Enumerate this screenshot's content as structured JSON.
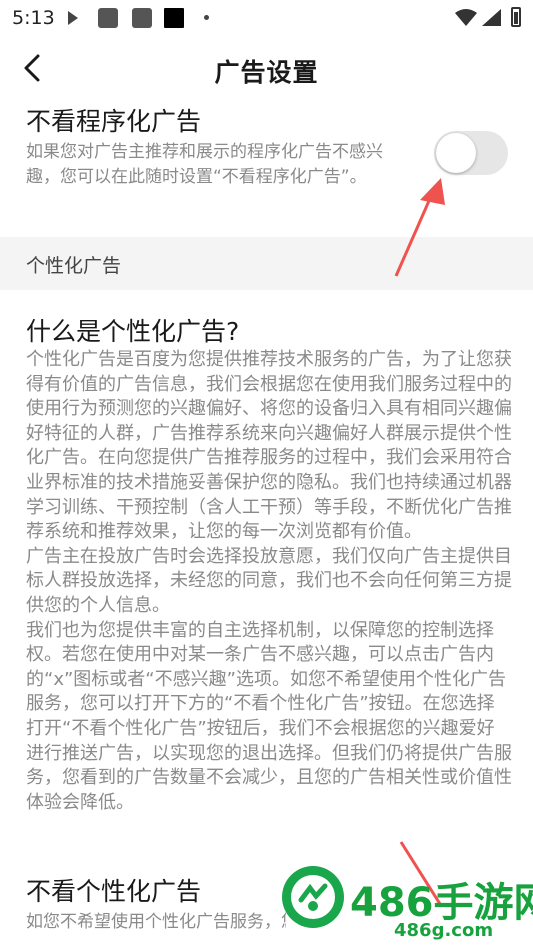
{
  "status_bar": {
    "time": "5:13"
  },
  "nav": {
    "title": "广告设置"
  },
  "programmatic": {
    "title": "不看程序化广告",
    "desc": "如果您对广告主推荐和展示的程序化广告不感兴趣，您可以在此随时设置“不看程序化广告”。",
    "toggle_on": false
  },
  "section": {
    "label": "个性化广告"
  },
  "info": {
    "title": "什么是个性化广告?",
    "paragraphs": [
      "个性化广告是百度为您提供推荐技术服务的广告，为了让您获得有价值的广告信息，我们会根据您在使用我们服务过程中的使用行为预测您的兴趣偏好、将您的设备归入具有相同兴趣偏好特征的人群，广告推荐系统来向兴趣偏好人群展示提供个性化广告。在向您提供广告推荐服务的过程中，我们会采用符合业界标准的技术措施妥善保护您的隐私。我们也持续通过机器学习训练、干预控制（含人工干预）等手段，不断优化广告推荐系统和推荐效果，让您的每一次浏览都有价值。",
      "广告主在投放广告时会选择投放意愿，我们仅向广告主提供目标人群投放选择，未经您的同意，我们也不会向任何第三方提供您的个人信息。",
      "我们也为您提供丰富的自主选择机制，以保障您的控制选择权。若您在使用中对某一条广告不感兴趣，可以点击广告内的“x”图标或者“不感兴趣”选项。如您不希望使用个性化广告服务，您可以打开下方的“不看个性化广告”按钮。在您选择打开“不看个性化广告”按钮后，我们不会根据您的兴趣爱好进行推送广告，以实现您的退出选择。但我们仍将提供广告服务，您看到的广告数量不会减少，且您的广告相关性或价值性体验会降低。"
    ]
  },
  "personalized": {
    "title": "不看个性化广告",
    "desc": "如您不希望使用个性化广告服务，您可以在此随时设置“不看个性化广告”。"
  },
  "watermark": {
    "brand": "486手游网",
    "domain": "486g.com"
  },
  "colors": {
    "annotation_arrow": "#f0524f",
    "toggle_track": "#e6e6e6",
    "watermark_green": "#17a23e"
  }
}
